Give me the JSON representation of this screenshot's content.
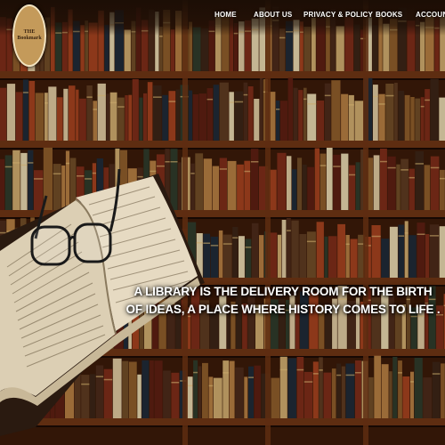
{
  "logo": {
    "line1": "THE",
    "line2": "Bookmark"
  },
  "nav": {
    "items": [
      {
        "id": "home",
        "label": "HOME"
      },
      {
        "id": "about",
        "label": "ABOUT US"
      },
      {
        "id": "privacy",
        "label": "PRIVACY & POLICY"
      },
      {
        "id": "books",
        "label": "BOOKS"
      },
      {
        "id": "account",
        "label": "ACCOUNT"
      }
    ]
  },
  "hero": {
    "quote": "A LIBRARY IS THE DELIVERY ROOM FOR THE BIRTH OF IDEAS, A PLACE WHERE HISTORY COMES TO LIFE ."
  },
  "colors": {
    "wood": "#6b3414",
    "wood_dark": "#3a1a08",
    "logo_bg": "#c49a5a",
    "text": "#ffffff"
  }
}
